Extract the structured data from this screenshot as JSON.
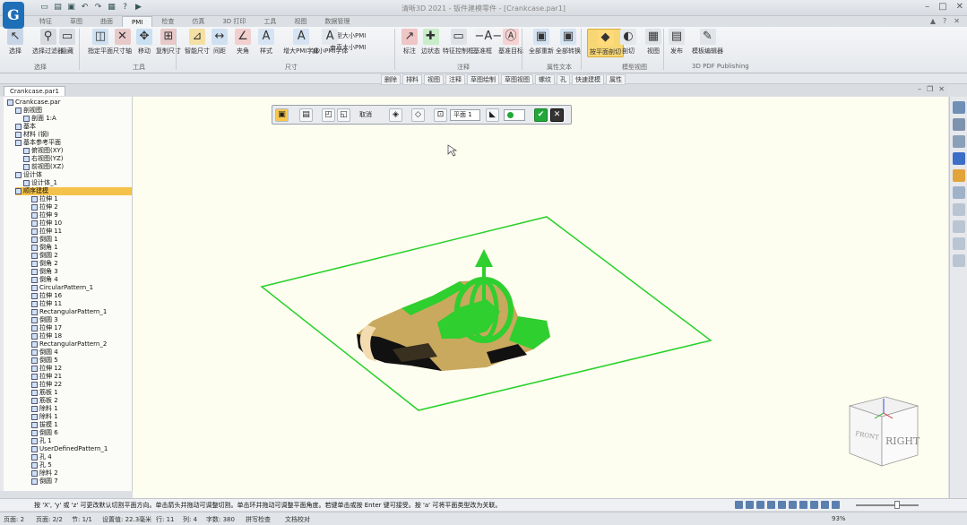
{
  "app": {
    "title": "清晰3D 2021 - 钣件建模零件 - [Crankcase.par1]",
    "logo_letter": "G"
  },
  "ribbon_tabs": [
    "特征",
    "草图",
    "曲面",
    "PMI",
    "检查",
    "仿真",
    "3D 打印",
    "工具",
    "视图",
    "数据管理"
  ],
  "ribbon": {
    "buttons": [
      {
        "label": "选择",
        "icon": "select-arrow-icon"
      },
      {
        "label": "选择过滤器",
        "icon": "filter-icon"
      },
      {
        "label": "隐藏",
        "icon": "hide-icon"
      },
      {
        "label": "指定平面",
        "icon": "plane-icon"
      },
      {
        "label": "尺寸轴",
        "icon": "dim-axis-icon"
      },
      {
        "label": "移动",
        "icon": "move-icon"
      },
      {
        "label": "复制尺寸",
        "icon": "copy-dim-icon"
      },
      {
        "label": "智能尺寸",
        "icon": "smart-dim-icon"
      },
      {
        "label": "间距",
        "icon": "distance-icon"
      },
      {
        "label": "夹角",
        "icon": "angle-icon"
      },
      {
        "label": "样式",
        "icon": "style-icon"
      },
      {
        "label": "增大PMI字体",
        "icon": "font-up-icon"
      },
      {
        "label": "减小PMI字体",
        "icon": "font-down-icon"
      },
      {
        "label": "标注",
        "icon": "callout-icon"
      },
      {
        "label": "边状态",
        "icon": "edge-state-icon"
      },
      {
        "label": "特征控制框",
        "icon": "fcf-icon"
      },
      {
        "label": "基准框",
        "icon": "datum-frame-icon"
      },
      {
        "label": "基准目标",
        "icon": "datum-target-icon"
      },
      {
        "label": "全部重新",
        "icon": "reset-all-icon"
      },
      {
        "label": "全部转换",
        "icon": "convert-all-icon"
      },
      {
        "label": "按平面剖切",
        "icon": "section-plane-icon"
      },
      {
        "label": "剖切",
        "icon": "cut-icon"
      },
      {
        "label": "视图",
        "icon": "view-icon"
      },
      {
        "label": "发布",
        "icon": "publish-icon"
      },
      {
        "label": "模板编辑器",
        "icon": "template-editor-icon"
      }
    ],
    "groups": [
      "选择",
      "工具",
      "尺寸",
      "注释",
      "属性文本",
      "模型视图",
      "3D PDF Publishing"
    ],
    "small_options": [
      "模型大小PMI",
      "垂直大小PMI"
    ]
  },
  "command_bar": [
    "删除",
    "排料",
    "视图",
    "注释",
    "草图绘制",
    "草图视图",
    "螺纹",
    "孔",
    "快速建模",
    "属性"
  ],
  "document_tab": "Crankcase.par1",
  "tree": [
    {
      "label": "Crankcase.par",
      "level": 0
    },
    {
      "label": "剖视图",
      "level": 1
    },
    {
      "label": "剖面 1:A",
      "level": 2
    },
    {
      "label": "基本",
      "level": 1
    },
    {
      "label": "材料 (钢)",
      "level": 1
    },
    {
      "label": "基本参考平面",
      "level": 1
    },
    {
      "label": "俯视图(XY)",
      "level": 2
    },
    {
      "label": "右视图(YZ)",
      "level": 2
    },
    {
      "label": "前视图(XZ)",
      "level": 2
    },
    {
      "label": "设计体",
      "level": 1
    },
    {
      "label": "设计体_1",
      "level": 2
    },
    {
      "label": "顺序建模",
      "level": 1,
      "selected": true
    },
    {
      "label": "拉伸 1",
      "level": 3
    },
    {
      "label": "拉伸 2",
      "level": 3
    },
    {
      "label": "拉伸 9",
      "level": 3
    },
    {
      "label": "拉伸 10",
      "level": 3
    },
    {
      "label": "拉伸 11",
      "level": 3
    },
    {
      "label": "倒圆 1",
      "level": 3
    },
    {
      "label": "倒角 1",
      "level": 3
    },
    {
      "label": "倒圆 2",
      "level": 3
    },
    {
      "label": "倒角 2",
      "level": 3
    },
    {
      "label": "倒角 3",
      "level": 3
    },
    {
      "label": "倒角 4",
      "level": 3
    },
    {
      "label": "CircularPattern_1",
      "level": 3
    },
    {
      "label": "拉伸 16",
      "level": 3
    },
    {
      "label": "拉伸 11",
      "level": 3
    },
    {
      "label": "RectangularPattern_1",
      "level": 3
    },
    {
      "label": "倒圆 3",
      "level": 3
    },
    {
      "label": "拉伸 17",
      "level": 3
    },
    {
      "label": "拉伸 18",
      "level": 3
    },
    {
      "label": "RectangularPattern_2",
      "level": 3
    },
    {
      "label": "倒圆 4",
      "level": 3
    },
    {
      "label": "倒圆 5",
      "level": 3
    },
    {
      "label": "拉伸 12",
      "level": 3
    },
    {
      "label": "拉伸 21",
      "level": 3
    },
    {
      "label": "拉伸 22",
      "level": 3
    },
    {
      "label": "筋板 1",
      "level": 3
    },
    {
      "label": "筋板 2",
      "level": 3
    },
    {
      "label": "除料 1",
      "level": 3
    },
    {
      "label": "除料 1",
      "level": 3
    },
    {
      "label": "拔模 1",
      "level": 3
    },
    {
      "label": "倒圆 6",
      "level": 3
    },
    {
      "label": "孔 1",
      "level": 3
    },
    {
      "label": "UserDefinedPattern_1",
      "level": 3
    },
    {
      "label": "孔 4",
      "level": 3
    },
    {
      "label": "孔 5",
      "level": 3
    },
    {
      "label": "除料 2",
      "level": 3
    },
    {
      "label": "倒圆 7",
      "level": 3
    }
  ],
  "viewport_bar": {
    "cancel_label": "取消",
    "plane_select": "平面 1",
    "accept_color": "#22a83a",
    "cancel_color": "#333333"
  },
  "viewcube": {
    "front_label": "FRONT",
    "right_label": "RIGHT"
  },
  "prompt": "按 'X', 'y' 或 'z' 可更改默认切割平面方向。单击箭头并拖动可调整切割。单击环并拖动可调整平面角度。若键单击或按 Enter 键可接受。按 'a' 可将平面类型改为关联。",
  "status": {
    "page": "页面: 2",
    "pages": "页面: 2/2",
    "section": "节: 1/1",
    "position": "设置值: 22.3毫米",
    "line": "行: 11",
    "col": "列: 4",
    "chars": "字数: 380",
    "spell": "拼写检查",
    "doc_check": "文档校对",
    "zoom": "93%"
  },
  "colors": {
    "section_plane": "#27d12a",
    "handle": "#2ecf2e",
    "part_body": "#c9a95e",
    "viewport_bg": "#fefef0",
    "accent": "#1f6fb8"
  }
}
